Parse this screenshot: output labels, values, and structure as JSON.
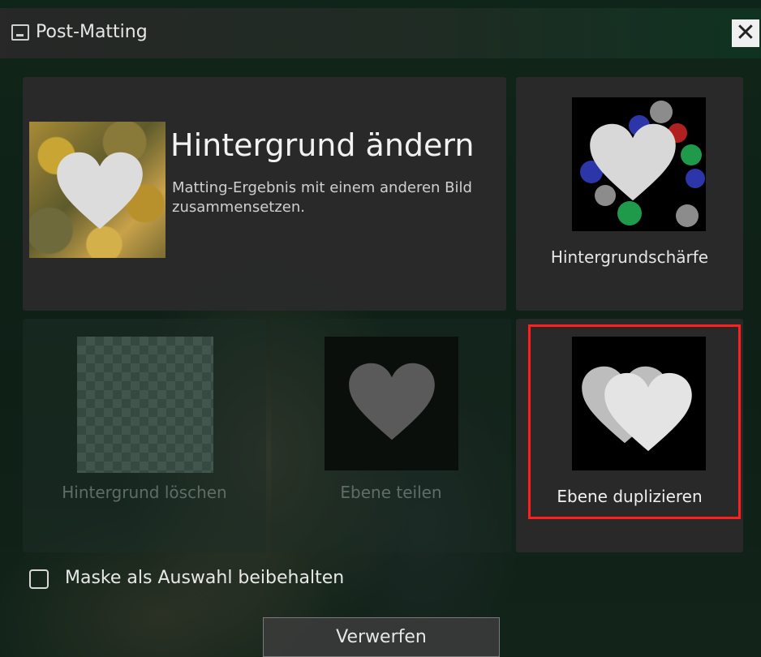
{
  "window": {
    "title": "Post-Matting"
  },
  "cards": {
    "change_background": {
      "title": "Hintergrund ändern",
      "description": "Matting-Ergebnis mit einem anderen Bild zusammensetzen."
    },
    "background_blur": {
      "label": "Hintergrundschärfe"
    },
    "delete_background": {
      "label": "Hintergrund löschen",
      "enabled": false
    },
    "split_layer": {
      "label": "Ebene teilen",
      "enabled": false
    },
    "duplicate_layer": {
      "label": "Ebene duplizieren",
      "highlighted": true
    }
  },
  "options": {
    "keep_mask_label": "Maske als Auswahl beibehalten",
    "keep_mask_checked": false
  },
  "buttons": {
    "discard_label": "Verwerfen"
  },
  "colors": {
    "highlight": "#ff1f1f",
    "card_bg": "#2a2a2a",
    "accent_green": "#0f2a1b"
  }
}
